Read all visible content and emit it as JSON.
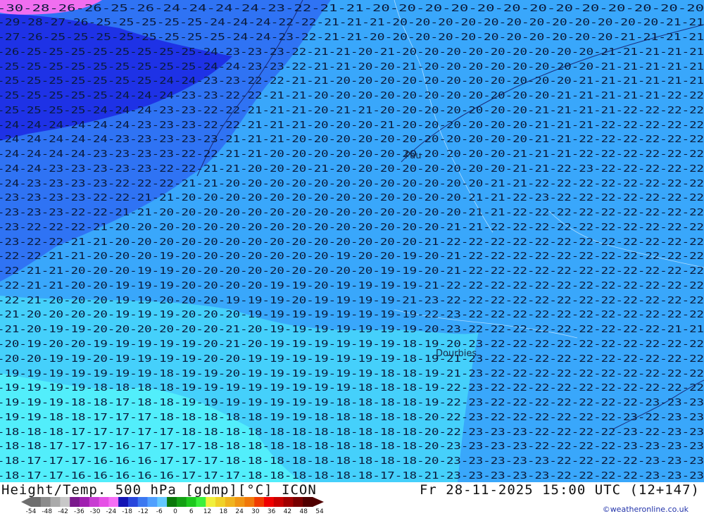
{
  "title": "Height/Temp. 500 hPa [gdmp][°C] ICON",
  "datetime": "Fr 28-11-2025 15:00 UTC (12+147)",
  "credit": "©weatheronline.co.uk",
  "places": [
    {
      "name": "Pau"
    },
    {
      "name": "Dourbies"
    }
  ],
  "legend": {
    "ticks": [
      "-54",
      "-48",
      "-42",
      "-36",
      "-30",
      "-24",
      "-18",
      "-12",
      "-6",
      "0",
      "6",
      "12",
      "18",
      "24",
      "30",
      "36",
      "42",
      "48",
      "54"
    ],
    "colors": [
      "#6e6e6e",
      "#8c8c8c",
      "#aaaaaa",
      "#c8c8c8",
      "#7a1a8c",
      "#a020b0",
      "#c83cd2",
      "#e650e6",
      "#f56ef5",
      "#1414b4",
      "#2846dc",
      "#3c78f0",
      "#50a0ff",
      "#64c8ff",
      "#0a780a",
      "#14a014",
      "#1ec81e",
      "#3cf03c",
      "#f0f03c",
      "#f0d228",
      "#f0b41e",
      "#f09614",
      "#f0780a",
      "#f03c00",
      "#f00000",
      "#c80000",
      "#a00000",
      "#780000",
      "#500000"
    ]
  },
  "map_colors": {
    "dark_blue": "#1e32e6",
    "mid_blue": "#2f73f4",
    "light_blue": "#39a7fb",
    "cyan": "#45d0fb",
    "light_cyan": "#52eefb",
    "pink": "#f06ef0"
  },
  "label_rows": [
    "-30-28-26-26-25-26-24-24-24-24-23-22-21-21-20-20-20-20-20-20-20-20-20-20-20-20-20",
    "-29-28-27-26-25-25-25-25-25-24-24-24-22-22-21-21-21-20-20-20-20-20-20-20-20-20-20-20-20-21-21",
    "-27-26-25-25-25-25-25-25-25-25-24-24-23-22-21-21-20-20-20-20-20-20-20-20-20-20-20-21-21-21-21",
    "-26-25-25-25-25-25-25-25-25-24-23-23-23-22-21-21-20-21-20-20-20-20-20-20-20-20-20-21-21-21-21-21",
    "-25-25-25-25-25-25-25-25-25-24-24-23-23-22-21-21-20-20-21-20-20-20-20-20-20-20-20-21-21-21-21-21",
    "-25-25-25-25-25-25-25-24-24-23-23-22-22-21-21-20-20-20-20-20-20-20-20-20-20-20-21-21-21-21-21-21",
    "-25-25-25-25-25-24-24-24-23-23-22-22-21-21-20-20-20-20-20-20-20-20-20-20-20-21-21-21-21-21-22-22",
    "-25-25-25-25-24-24-24-23-23-22-22-21-21-21-20-21-21-20-20-20-20-20-20-20-21-21-21-21-22-22-22-22",
    "-24-24-24-24-24-24-23-23-23-22-22-21-21-21-20-20-20-21-20-20-20-20-20-20-21-21-21-22-22-22-22-22",
    "-24-24-24-24-24-23-23-23-23-23-21-21-21-20-20-20-20-20-20-20-20-20-20-20-21-21-22-22-22-22-22-22",
    "-24-24-24-24-23-23-23-23-22-22-21-21-20-20-20-20-20-20-20-20-20-20-20-21-21-21-22-22-22-22-22-22",
    "-24-24-23-23-23-23-23-22-22-21-21-20-20-20-21-20-20-20-20-20-20-20-20-21-21-22-23-22-22-22-22-22",
    "-24-23-23-23-23-22-22-22-21-21-20-20-20-20-20-20-20-20-20-20-20-20-21-21-22-22-22-22-22-22-22-22",
    "-23-23-23-23-22-22-21-21-20-20-20-20-20-20-20-20-20-20-20-20-20-21-21-22-23-22-22-22-22-22-22-22",
    "-23-23-23-22-22-21-21-20-20-20-20-20-20-20-20-20-20-20-20-20-20-21-21-22-22-22-22-22-22-22-22-22",
    "-23-22-22-22-21-20-20-20-20-20-20-20-20-20-20-20-20-20-20-20-21-21-22-22-22-22-22-22-22-22-22-22",
    "-23-22-22-21-21-20-20-20-20-20-20-20-20-20-20-20-20-20-20-21-22-22-22-22-22-22-22-22-22-22-22-22",
    "-22-22-21-21-20-20-20-19-20-20-20-20-20-20-20-19-20-20-19-20-21-22-22-22-22-22-22-22-22-22-22-22",
    "-22-21-21-20-20-20-19-19-20-20-20-20-20-20-20-20-20-19-19-20-21-22-22-22-22-22-22-22-22-22-22-22",
    "-22-21-21-20-20-19-19-19-20-20-20-20-19-19-20-19-19-19-19-21-22-22-22-22-22-22-22-22-22-22-22-22",
    "-22-21-20-20-20-19-19-20-20-20-19-19-19-20-19-19-19-19-21-23-22-22-22-22-22-22-22-22-22-22-22-22",
    "-21-20-20-20-20-19-19-19-20-20-20-19-19-19-19-19-19-19-19-22-23-22-22-22-22-22-22-22-22-22-22-22",
    "-21-20-19-19-20-20-20-20-20-20-21-20-19-19-19-19-19-19-19-20-23-22-22-22-22-22-22-22-22-22-21-21",
    "-20-19-20-20-19-19-19-19-19-20-21-20-19-19-19-19-19-19-18-19-20-23-22-22-22-22-22-22-22-22-22-22",
    "-20-20-19-19-20-19-19-19-19-20-20-19-19-19-19-19-19-19-18-19-21-23-22-22-22-22-22-22-22-22-22-22",
    "-19-19-19-19-19-19-19-18-19-19-20-19-19-19-19-19-19-18-18-19-21-23-22-22-22-22-22-22-22-22-22-22",
    "-19-19-19-19-18-18-18-18-19-19-19-19-19-19-19-19-18-18-18-19-22-23-22-22-22-22-22-22-22-22-22-22",
    "-19-19-19-18-18-17-18-18-19-19-19-19-19-19-19-18-18-18-18-19-22-23-22-22-22-22-22-22-22-23-23-23",
    "-19-19-18-18-17-17-17-18-18-18-18-18-19-19-18-18-18-18-18-20-22-23-22-22-22-22-22-22-23-22-23-23",
    "-18-18-18-17-17-17-17-17-18-18-18-18-18-18-18-18-18-18-18-20-22-23-23-23-22-22-22-22-23-22-23-23",
    "-18-18-17-17-17-16-17-17-17-18-18-18-18-18-18-18-18-18-18-20-23-23-23-23-22-22-22-22-23-23-23-23",
    "-18-17-17-17-16-16-16-17-17-17-18-18-18-18-18-18-18-18-18-20-23-23-23-23-23-22-22-22-22-23-23-23",
    "-18-17-17-16-16-16-16-16-17-17-17-18-18-18-18-18-18-17-18-21-23-23-23-23-23-22-22-22-22-23-23-23"
  ]
}
